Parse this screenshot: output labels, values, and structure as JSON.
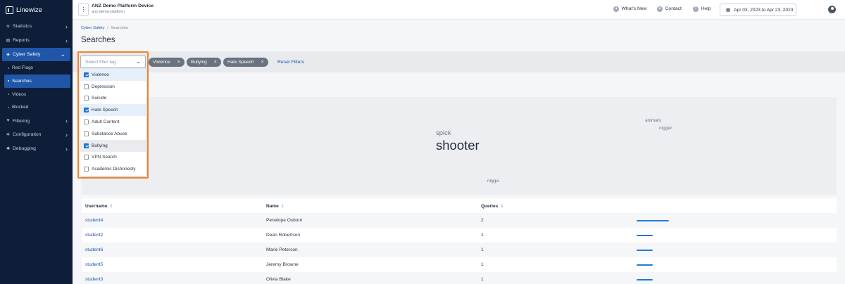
{
  "sidebar": {
    "brand": "Linewize",
    "items": [
      {
        "label": "Statistics",
        "icon": "chart-icon"
      },
      {
        "label": "Reports",
        "icon": "document-icon"
      },
      {
        "label": "Cyber Safety",
        "icon": "shield-icon"
      },
      {
        "label": "Filtering",
        "icon": "funnel-icon"
      },
      {
        "label": "Configuration",
        "icon": "gear-icon"
      },
      {
        "label": "Debugging",
        "icon": "bug-icon"
      }
    ],
    "sub_items": [
      {
        "label": "Red Flags"
      },
      {
        "label": "Searches"
      },
      {
        "label": "Videos"
      },
      {
        "label": "Blocked"
      }
    ]
  },
  "topbar": {
    "device_title": "ANZ Demo Platform Device",
    "device_subtitle": "anz-demo-platform",
    "whats_new": "What's New",
    "contact": "Contact",
    "help": "Help",
    "date_range": "Apr 03, 2023 to Apr 23, 2023"
  },
  "breadcrumb": {
    "parent": "Cyber Safety",
    "separator": "/",
    "current": "Searches"
  },
  "page_title": "Searches",
  "filter": {
    "placeholder": "Select filter tag",
    "chips": [
      "Violence",
      "Bullying",
      "Hate Speech"
    ],
    "reset_label": "Reset Filters",
    "options": [
      {
        "label": "Violence",
        "checked": true
      },
      {
        "label": "Depression",
        "checked": false
      },
      {
        "label": "Suicide",
        "checked": false
      },
      {
        "label": "Hate Speech",
        "checked": true
      },
      {
        "label": "Adult Content",
        "checked": false
      },
      {
        "label": "Substance Abuse",
        "checked": false
      },
      {
        "label": "Bullying",
        "checked": true
      },
      {
        "label": "VPN Search",
        "checked": false
      },
      {
        "label": "Academic Dishonesty",
        "checked": false
      }
    ]
  },
  "word_cloud": [
    "spick",
    "shooter",
    "animals",
    "nigger",
    "nigga"
  ],
  "table": {
    "headers": {
      "username": "Username",
      "name": "Name",
      "queries": "Queries"
    },
    "rows": [
      {
        "username": "student4",
        "name": "Penelope Osborn",
        "queries": "2",
        "bar_fraction": 1.0
      },
      {
        "username": "student2",
        "name": "Dean Robertson",
        "queries": "1",
        "bar_fraction": 0.5
      },
      {
        "username": "student6",
        "name": "Marie Peterson",
        "queries": "1",
        "bar_fraction": 0.5
      },
      {
        "username": "student5",
        "name": "Jeremy Browne",
        "queries": "1",
        "bar_fraction": 0.5
      },
      {
        "username": "student3",
        "name": "Olivia Blake",
        "queries": "1",
        "bar_fraction": 0.5
      }
    ]
  },
  "colors": {
    "sidebar_bg": "#0e1e38",
    "accent": "#1f56a8",
    "highlight": "#f0852d",
    "bar": "#1f7ad6"
  }
}
